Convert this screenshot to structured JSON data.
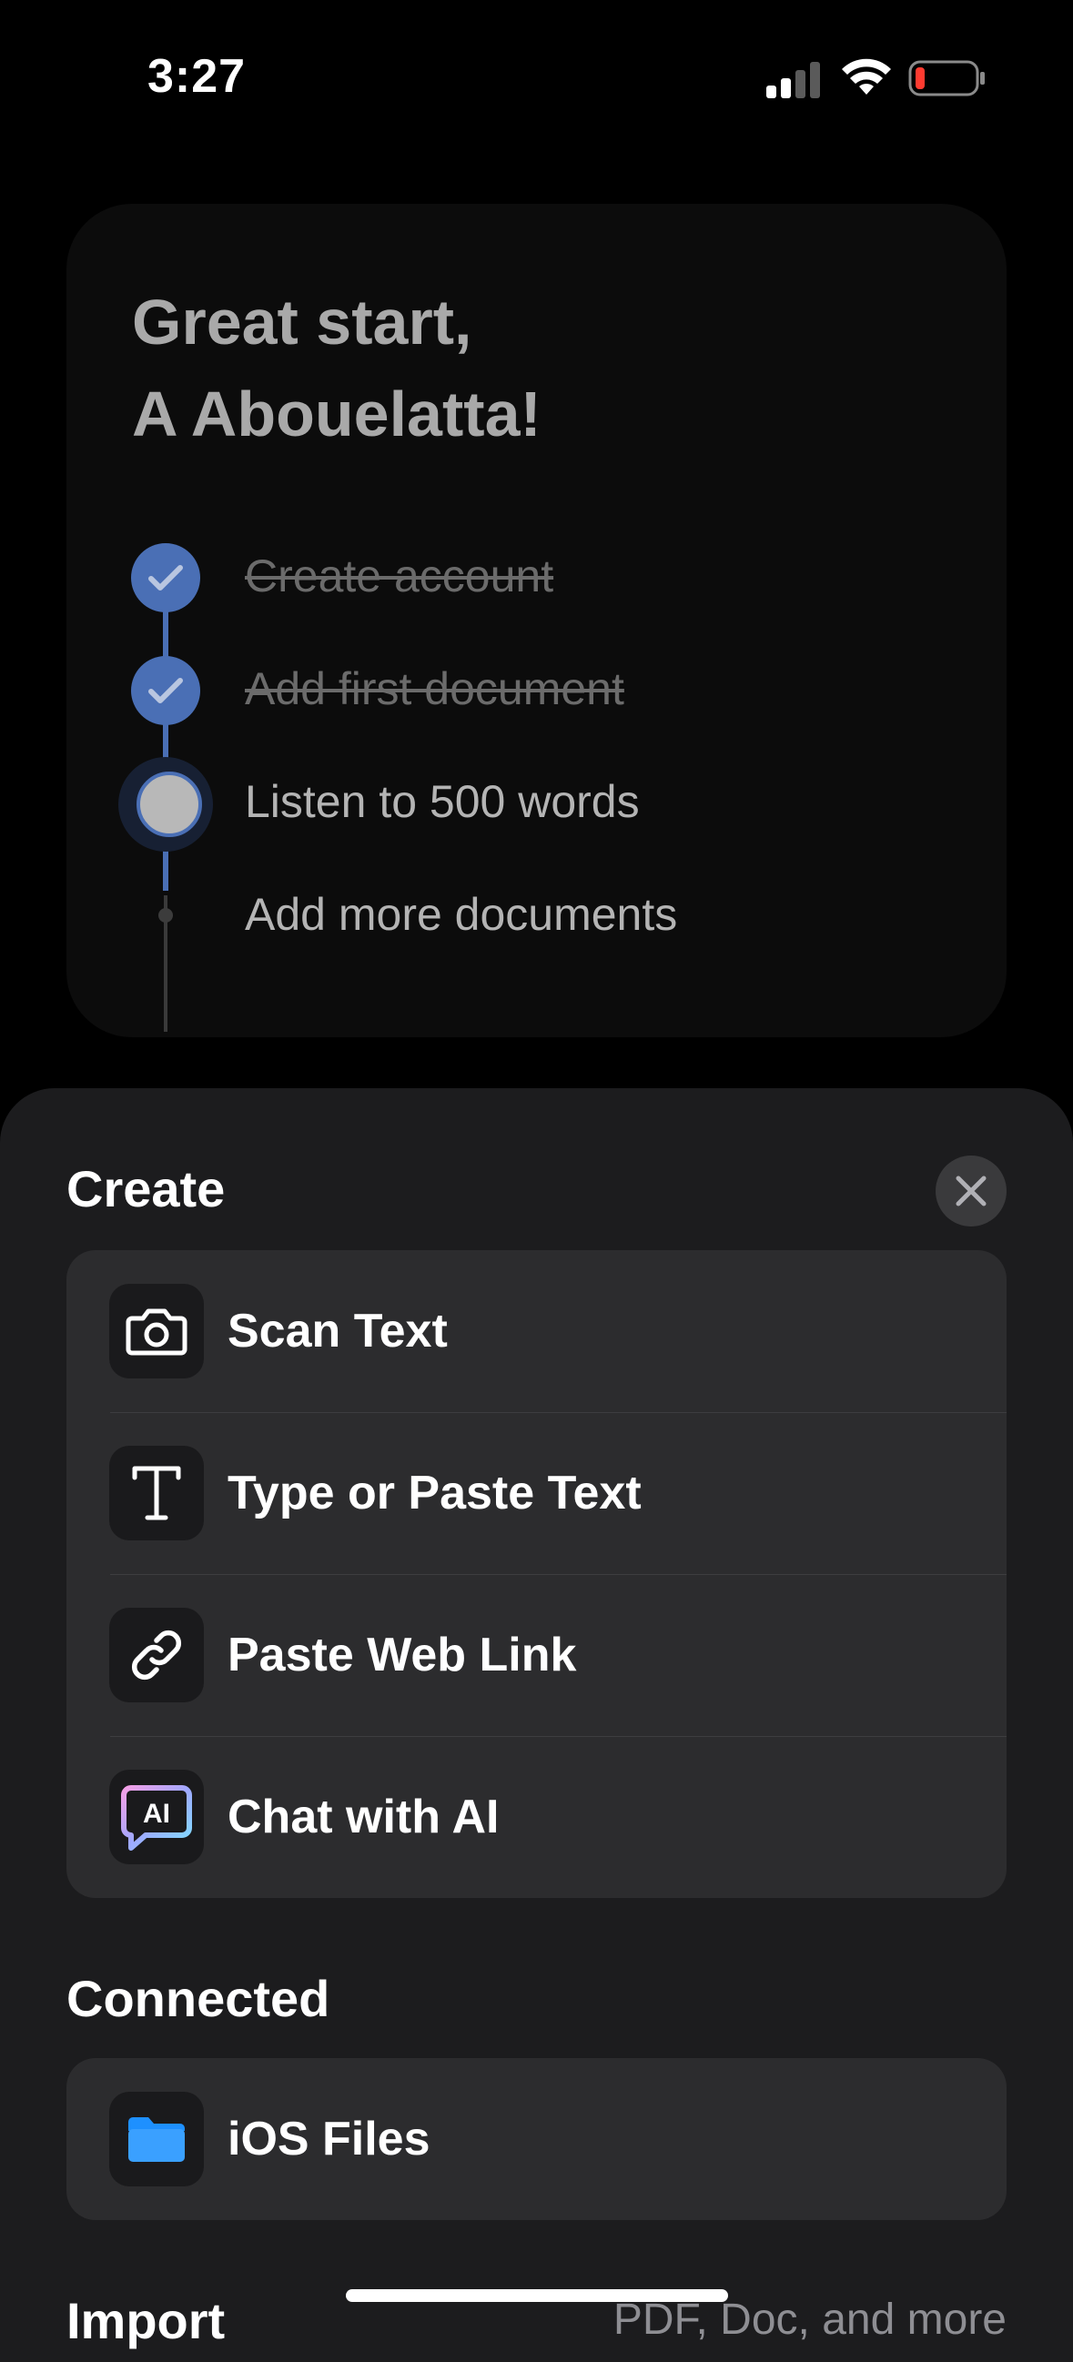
{
  "status_bar": {
    "time": "3:27"
  },
  "progress_card": {
    "greeting_line1": "Great start,",
    "greeting_line2": "A Abouelatta!",
    "steps": [
      {
        "label": "Create account",
        "state": "done"
      },
      {
        "label": "Add first document",
        "state": "done"
      },
      {
        "label": "Listen to 500 words",
        "state": "current"
      },
      {
        "label": "Add more documents",
        "state": "pending"
      }
    ]
  },
  "sheet": {
    "create_title": "Create",
    "create_items": [
      {
        "label": "Scan Text",
        "icon": "camera-icon"
      },
      {
        "label": "Type or Paste Text",
        "icon": "text-t-icon"
      },
      {
        "label": "Paste Web Link",
        "icon": "link-icon"
      },
      {
        "label": "Chat with AI",
        "icon": "ai-chat-icon"
      }
    ],
    "connected_title": "Connected",
    "connected_items": [
      {
        "label": "iOS Files",
        "icon": "folder-icon"
      }
    ],
    "import_title": "Import",
    "import_subtitle": "PDF, Doc, and more"
  },
  "colors": {
    "accent": "#4a6fb5",
    "folder_blue": "#1e90ff",
    "battery_low": "#ff3b30"
  }
}
